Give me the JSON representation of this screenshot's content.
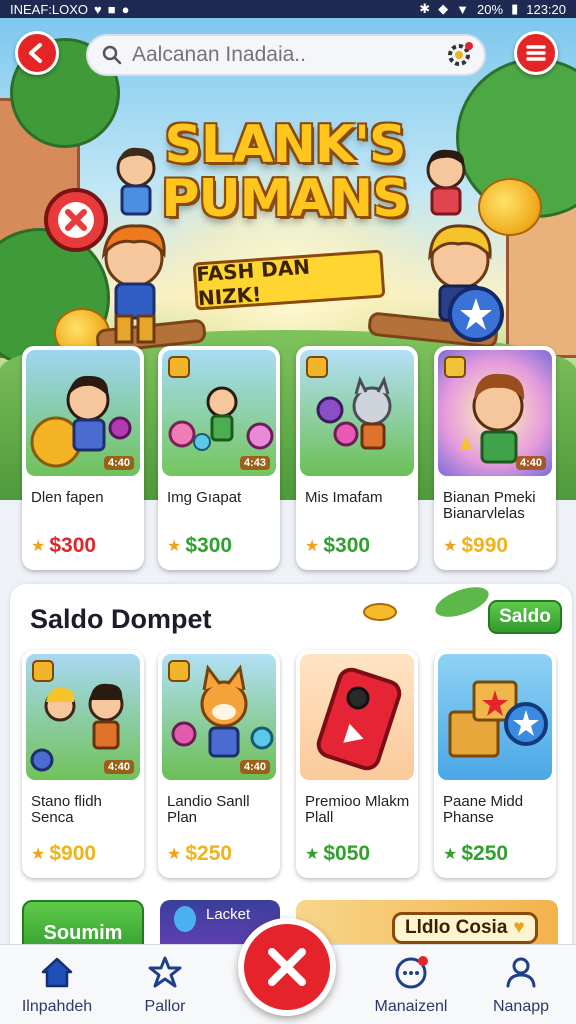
{
  "status_bar": {
    "left_text": "INEAF:LOXO",
    "battery": "20%",
    "time": "123:20"
  },
  "search": {
    "placeholder": "Aalcanan Inadaia.."
  },
  "banner": {
    "title_line1": "SLANK'S",
    "title_line2": "PUMANS",
    "ribbon": "FASH DAN NIZK!"
  },
  "featured": [
    {
      "name": "Dlen fapen",
      "price": "$300",
      "price_color": "#e0262b",
      "level": "4:40"
    },
    {
      "name": "Img Gıapat",
      "price": "$300",
      "price_color": "#2fa12c",
      "level": "4:43"
    },
    {
      "name": "Mis Imafam",
      "price": "$300",
      "price_color": "#2fa12c",
      "level": ""
    },
    {
      "name": "Bianan Pmeki Bianarvlelas",
      "price": "$990",
      "price_color": "#f0b21d",
      "level": "4:40"
    }
  ],
  "wallet_section": {
    "title": "Saldo Dompet",
    "button": "Saldo",
    "items": [
      {
        "name": "Stano flidh Senca",
        "price": "$900",
        "price_color": "#f0b21d",
        "level": "4:40"
      },
      {
        "name": "Landio Sanll Plan",
        "price": "$250",
        "price_color": "#f0b21d",
        "level": "4:40"
      },
      {
        "name": "Premioo Mlakm Plall",
        "price": "$050",
        "price_color": "#2fa12c",
        "level": ""
      },
      {
        "name": "Paane Midd Phanse",
        "price": "$250",
        "price_color": "#2fa12c",
        "level": ""
      }
    ]
  },
  "partial_row": {
    "left": "Soumim",
    "middle": "Lacket",
    "right": "Lldlo Cosia"
  },
  "nav": [
    {
      "label": "Ilnpahdeh",
      "icon": "home-icon"
    },
    {
      "label": "Pallor",
      "icon": "star-icon"
    },
    {
      "label": "Manaizenl",
      "icon": "chat-icon"
    },
    {
      "label": "Nanapp",
      "icon": "user-icon"
    }
  ]
}
